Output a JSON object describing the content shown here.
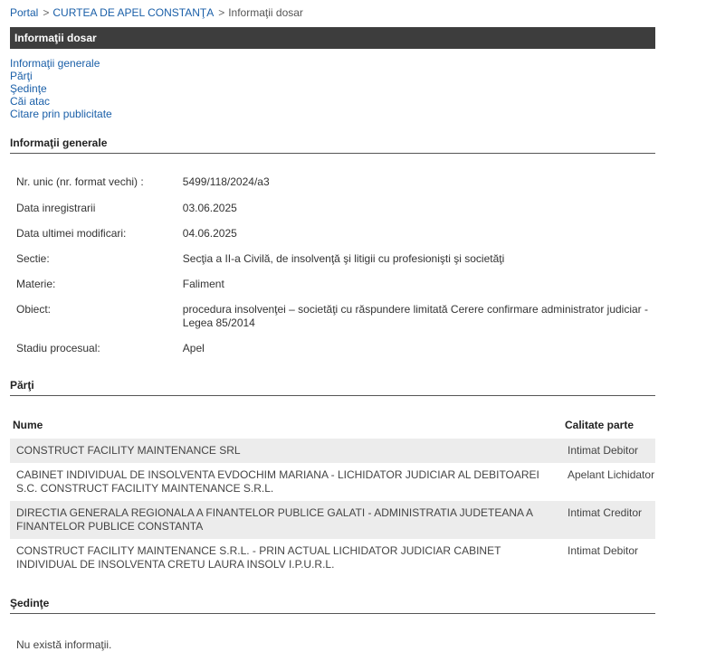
{
  "breadcrumb": {
    "portal": "Portal",
    "sep": ">",
    "court": "CURTEA DE APEL CONSTANŢA",
    "current": "Informaţii dosar"
  },
  "title": "Informaţii dosar",
  "toc": [
    "Informaţii generale",
    "Părţi",
    "Şedinţe",
    "Căi atac",
    "Citare prin publicitate"
  ],
  "general": {
    "heading": "Informaţii generale",
    "rows": [
      {
        "label": "Nr. unic (nr. format vechi) :",
        "value": "5499/118/2024/a3"
      },
      {
        "label": "Data inregistrarii",
        "value": "03.06.2025"
      },
      {
        "label": "Data ultimei modificari:",
        "value": "04.06.2025"
      },
      {
        "label": "Sectie:",
        "value": "Secţia a II-a Civilă, de insolvenţă şi litigii cu profesionişti şi societăţi"
      },
      {
        "label": "Materie:",
        "value": "Faliment"
      },
      {
        "label": "Obiect:",
        "value": "procedura insolvenţei – societăţi cu răspundere limitată Cerere confirmare administrator judiciar - Legea 85/2014"
      },
      {
        "label": "Stadiu procesual:",
        "value": "Apel"
      }
    ]
  },
  "parti": {
    "heading": "Părţi",
    "col_nume": "Nume",
    "col_calitate": "Calitate parte",
    "rows": [
      {
        "nume": "CONSTRUCT FACILITY MAINTENANCE SRL",
        "calitate": "Intimat Debitor"
      },
      {
        "nume": "CABINET INDIVIDUAL DE INSOLVENTA EVDOCHIM MARIANA - LICHIDATOR JUDICIAR AL DEBITOAREI S.C. CONSTRUCT FACILITY MAINTENANCE S.R.L.",
        "calitate": "Apelant Lichidator"
      },
      {
        "nume": "DIRECTIA GENERALA REGIONALA A FINANTELOR PUBLICE GALATI - ADMINISTRATIA JUDETEANA A FINANTELOR PUBLICE CONSTANTA",
        "calitate": "Intimat Creditor"
      },
      {
        "nume": "CONSTRUCT FACILITY MAINTENANCE S.R.L. - PRIN ACTUAL LICHIDATOR JUDICIAR CABINET INDIVIDUAL DE INSOLVENTA CRETU LAURA INSOLV I.P.U.R.L.",
        "calitate": "Intimat Debitor"
      }
    ]
  },
  "sedinte": {
    "heading": "Şedinţe",
    "empty_text": "Nu există informaţii."
  }
}
